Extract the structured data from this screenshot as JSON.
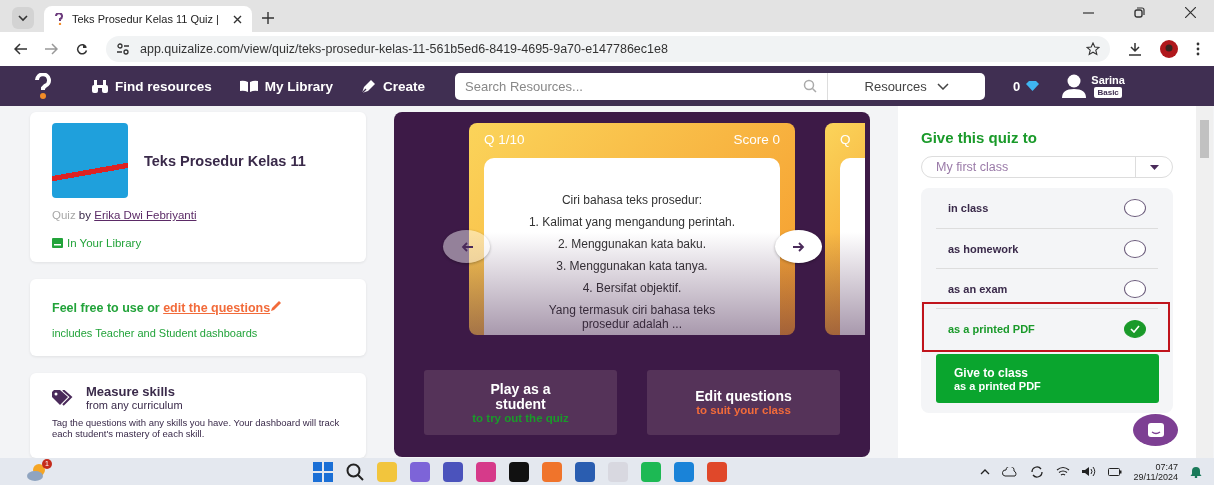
{
  "browser": {
    "tab_title": "Teks Prosedur Kelas 11 Quiz |",
    "url": "app.quizalize.com/view/quiz/teks-prosedur-kelas-11-561b5ed6-8419-4695-9a70-e147786ec1e8"
  },
  "site_nav": {
    "items": [
      "Find resources",
      "My Library",
      "Create"
    ],
    "search_placeholder": "Search Resources...",
    "dropdown": "Resources",
    "gems": "0",
    "user_name": "Sarina",
    "plan": "Basic"
  },
  "quiz": {
    "title": "Teks Prosedur Kelas 11",
    "type_label": "Quiz",
    "by": "by",
    "author": "Erika Dwi Febriyanti",
    "library_status": "In Your Library"
  },
  "promo": {
    "text": "Feel free to use or",
    "link": "edit the questions",
    "subtext": "includes Teacher and Student dashboards"
  },
  "skills": {
    "title": "Measure skills",
    "subtitle": "from any curriculum",
    "description": "Tag the questions with any skills you have. Your dashboard will track each student's mastery of each skill."
  },
  "preview": {
    "counter": "Q 1/10",
    "score": "Score 0",
    "lines": [
      "Ciri bahasa teks prosedur:",
      "1. Kalimat yang mengandung perintah.",
      "2. Menggunakan kata baku.",
      "3. Menggunakan kata tanya.",
      "4. Bersifat objektif.",
      "Yang termasuk ciri bahasa teks prosedur adalah ..."
    ],
    "next_counter": "Q",
    "buttons": [
      {
        "title": "Play as a student",
        "subtitle": "to try out the quiz",
        "kind": "play"
      },
      {
        "title": "Edit questions",
        "subtitle": "to suit your class",
        "kind": "edit"
      }
    ]
  },
  "give": {
    "heading": "Give this quiz to",
    "class_value": "My first class",
    "options": [
      {
        "label": "in class",
        "selected": false,
        "highlighted": false
      },
      {
        "label": "as homework",
        "selected": false,
        "highlighted": false
      },
      {
        "label": "as an exam",
        "selected": false,
        "highlighted": false
      },
      {
        "label": "as a printed PDF",
        "selected": true,
        "highlighted": true
      }
    ],
    "button_title": "Give to class",
    "button_subtitle": "as a printed PDF"
  },
  "taskbar": {
    "badge": "1",
    "time": "07:47",
    "date": "29/11/2024"
  }
}
